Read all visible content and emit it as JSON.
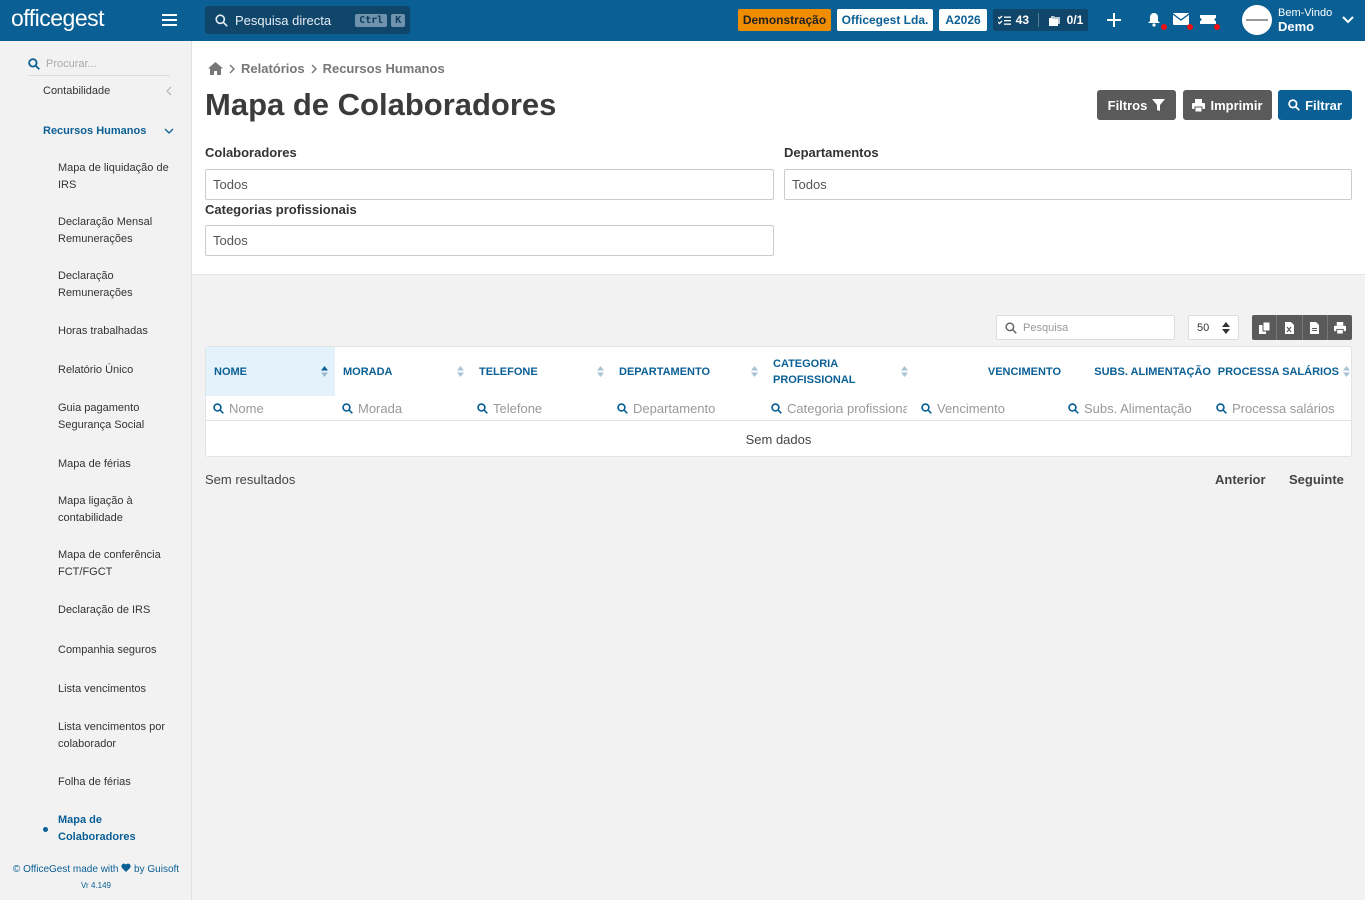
{
  "app": {
    "logo": "officegest"
  },
  "topbar": {
    "search_label": "Pesquisa directa",
    "shortcut_ctrl": "Ctrl",
    "shortcut_key": "K",
    "mode_badge": "Demonstração",
    "company": "Officegest Lda.",
    "year": "A2026",
    "tasks_count": "43",
    "docs_count": "0/1",
    "welcome": "Bem-Vindo",
    "user_name": "Demo",
    "colors": {
      "bar": "#0a5f95",
      "demo_badge": "#f08c00",
      "notification": "#e11111"
    }
  },
  "sidebar": {
    "search_placeholder": "Procurar...",
    "sections": [
      {
        "label": "Contabilidade"
      },
      {
        "label": "Recursos Humanos"
      }
    ],
    "items": [
      {
        "label": "Mapa de liquidação de IRS"
      },
      {
        "label": "Declaração Mensal Remunerações"
      },
      {
        "label": "Declaração Remunerações"
      },
      {
        "label": "Horas trabalhadas"
      },
      {
        "label": "Relatório Único"
      },
      {
        "label": "Guia pagamento Segurança Social"
      },
      {
        "label": "Mapa de férias"
      },
      {
        "label": "Mapa ligação à contabilidade"
      },
      {
        "label": "Mapa de conferência FCT/FGCT"
      },
      {
        "label": "Declaração de IRS"
      },
      {
        "label": "Companhia seguros"
      },
      {
        "label": "Lista vencimentos"
      },
      {
        "label": "Lista vencimentos por colaborador"
      },
      {
        "label": "Folha de férias"
      },
      {
        "label": "Mapa de Colaboradores"
      }
    ],
    "footer_prefix": "© OfficeGest made with",
    "footer_suffix": "by Guisoft",
    "version": "Vr 4.149"
  },
  "breadcrumb": {
    "level1": "Relatórios",
    "level2": "Recursos Humanos"
  },
  "page": {
    "title": "Mapa de Colaboradores",
    "btn_filtros": "Filtros",
    "btn_imprimir": "Imprimir",
    "btn_filtrar": "Filtrar"
  },
  "filters": {
    "colaboradores_label": "Colaboradores",
    "colaboradores_value": "Todos",
    "departamentos_label": "Departamentos",
    "departamentos_value": "Todos",
    "categorias_label": "Categorias profissionais",
    "categorias_value": "Todos"
  },
  "table": {
    "search_placeholder": "Pesquisa",
    "page_size": "50",
    "columns": [
      {
        "header": "NOME",
        "filter": "Nome"
      },
      {
        "header": "MORADA",
        "filter": "Morada"
      },
      {
        "header": "TELEFONE",
        "filter": "Telefone"
      },
      {
        "header": "DEPARTAMENTO",
        "filter": "Departamento"
      },
      {
        "header": "CATEGORIA PROFISSIONAL",
        "filter": "Categoria profissional"
      },
      {
        "header": "VENCIMENTO",
        "filter": "Vencimento"
      },
      {
        "header": "SUBS. ALIMENTAÇÃO",
        "filter": "Subs. Alimentação"
      },
      {
        "header": "PROCESSA SALÁRIOS",
        "filter": "Processa salários"
      }
    ],
    "empty_text": "Sem dados",
    "results_text": "Sem resultados",
    "prev_label": "Anterior",
    "next_label": "Seguinte"
  }
}
